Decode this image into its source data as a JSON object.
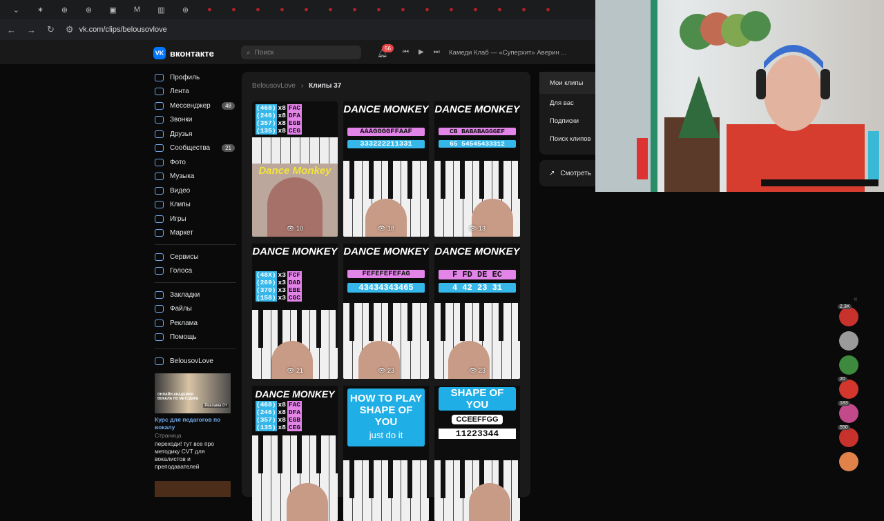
{
  "browser": {
    "url": "vk.com/clips/belousovlove",
    "tabs": [
      "⌄",
      "✶",
      "⊛",
      "⊛",
      "▣",
      "M",
      "▥",
      "⊛",
      "●",
      "●",
      "●",
      "●",
      "●",
      "●",
      "●",
      "●",
      "●",
      "●",
      "●",
      "●",
      "●",
      "●",
      "●"
    ]
  },
  "header": {
    "logo": "вконтакте",
    "logo_mark": "VK",
    "search_placeholder": "Поиск",
    "notifications": "56",
    "now_playing": "Камеди Клаб — «Суперхит» Аверин ..."
  },
  "sidebar": {
    "groups": [
      [
        {
          "label": "Профиль"
        },
        {
          "label": "Лента"
        },
        {
          "label": "Мессенджер",
          "count": "48"
        },
        {
          "label": "Звонки"
        },
        {
          "label": "Друзья"
        },
        {
          "label": "Сообщества",
          "count": "21"
        },
        {
          "label": "Фото"
        },
        {
          "label": "Музыка"
        },
        {
          "label": "Видео"
        },
        {
          "label": "Клипы"
        },
        {
          "label": "Игры"
        },
        {
          "label": "Маркет"
        }
      ],
      [
        {
          "label": "Сервисы"
        },
        {
          "label": "Голоса"
        }
      ],
      [
        {
          "label": "Закладки"
        },
        {
          "label": "Файлы"
        },
        {
          "label": "Реклама"
        },
        {
          "label": "Помощь"
        }
      ],
      [
        {
          "label": "BelousovLove"
        }
      ]
    ]
  },
  "ad": {
    "image_caption": "ОНЛАЙН АКАДЕМИЯ ВОКАЛА ПО МЕТОДИКЕ",
    "age": "Реклама 0+",
    "title": "Курс для педагогов по вокалу",
    "type": "Страница",
    "text": "переходи! тут все про методику CVT для вокалистов и преподавателей"
  },
  "main": {
    "breadcrumb_owner": "BelousovLove",
    "breadcrumb_sep": "›",
    "breadcrumb_current": "Клипы 37",
    "clips": {
      "c1": {
        "r1a": "(468)",
        "r1b": "FAC",
        "r2a": "(246)",
        "r2b": "DFA",
        "r3a": "(357)",
        "r3b": "EGB",
        "r4a": "(135)",
        "r4b": "CEG",
        "x": "x8",
        "caption": "Dance Monkey",
        "views": "10"
      },
      "c2": {
        "title": "DANCE MONKEY",
        "notes": "AAAGGGGFFAAF",
        "nums": "333222211331",
        "views": "18"
      },
      "c3": {
        "title": "DANCE MONKEY",
        "notes": "CB BABABAGGGEF",
        "nums": "65 54545433312",
        "views": "13"
      },
      "c4": {
        "title": "DANCE MONKEY",
        "r1a": "(48X)",
        "r1b": "FCF",
        "r2a": "(269)",
        "r2b": "DAD",
        "r3a": "(370)",
        "r3b": "EBE",
        "r4a": "(158)",
        "r4b": "CGC",
        "x": "x3",
        "views": "21"
      },
      "c5": {
        "title": "DANCE MONKEY",
        "notes": "FEFEFEFEFAG",
        "nums": "43434343465",
        "views": "23"
      },
      "c6": {
        "title": "DANCE MONKEY",
        "notes": "F FD DE EC",
        "nums": "4 42 23 31",
        "views": "23"
      },
      "c7": {
        "title": "DANCE MONKEY",
        "r1a": "(468)",
        "r1b": "FAC",
        "r2a": "(246)",
        "r2b": "DFA",
        "r3a": "(357)",
        "r3b": "EGB",
        "r4a": "(135)",
        "r4b": "CEG",
        "x": "x8"
      },
      "c8": {
        "how": "HOW TO PLAY",
        "song": "SHAPE OF YOU",
        "just": "just do it"
      },
      "c9": {
        "title": "SHAPE OF YOU",
        "notes": "CCEEFFGG",
        "nums": "11223344"
      }
    }
  },
  "right_panel": {
    "items": [
      "Мои клипы",
      "Для вас",
      "Подписки",
      "Поиск клипов"
    ],
    "stats": "Смотреть"
  },
  "dock": {
    "badges": [
      "2,3K",
      "",
      "",
      "20",
      "183",
      "550",
      ""
    ]
  },
  "colors": {
    "vk_blue": "#0077ff",
    "link": "#71aaeb",
    "pink": "#e384e8",
    "cyan": "#36b7ea"
  }
}
